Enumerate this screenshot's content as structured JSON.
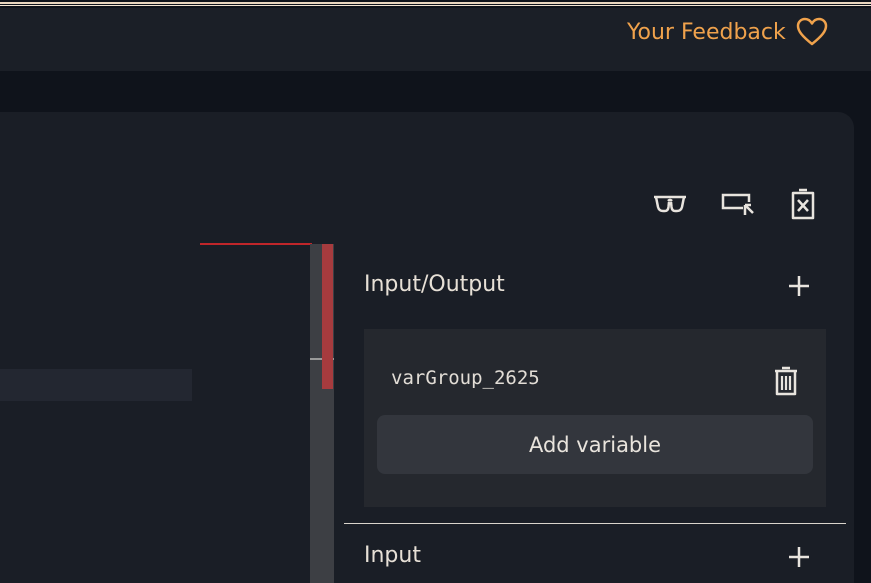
{
  "header": {
    "feedback_label": "Your Feedback",
    "feedback_icon": "heart-outline-icon",
    "accent_color": "#f0a24c"
  },
  "toolbar": {
    "icons": [
      "glasses-icon",
      "cursor-select-icon",
      "delete-file-icon"
    ]
  },
  "sidebar": {
    "sections": [
      {
        "title": "Input/Output",
        "add_icon": "plus-icon",
        "groups": [
          {
            "name": "varGroup_2625",
            "delete_icon": "trash-icon",
            "add_variable_label": "Add variable"
          }
        ]
      },
      {
        "title": "Input",
        "add_icon": "plus-icon"
      }
    ]
  },
  "colors": {
    "scroll_thumb": "#a63b3e",
    "link_line": "#c0262a"
  }
}
